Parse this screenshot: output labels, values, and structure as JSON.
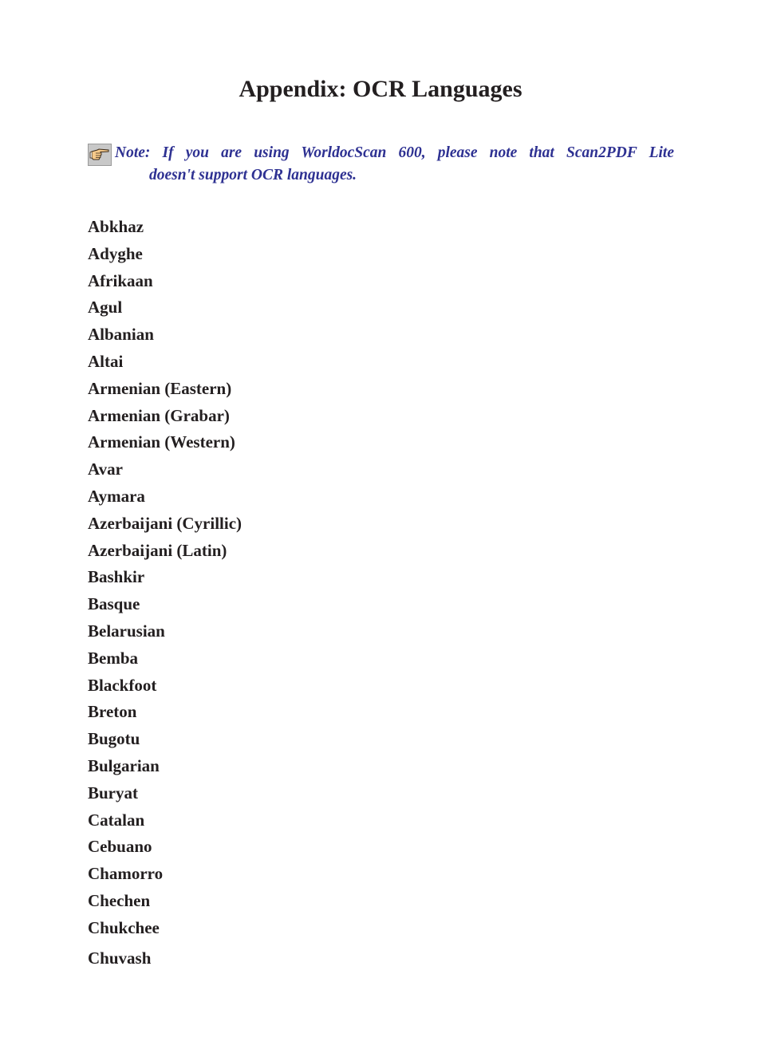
{
  "page": {
    "title": "Appendix: OCR Languages"
  },
  "note": {
    "icon": "pointing-hand-icon",
    "line1": "Note: If you are using WorldocScan 600, please note that Scan2PDF Lite",
    "line2": "doesn't support OCR languages.",
    "color": "#2e3192"
  },
  "languages": [
    "Abkhaz",
    "Adyghe",
    "Afrikaan",
    "Agul",
    "Albanian",
    "Altai",
    "Armenian (Eastern)",
    "Armenian (Grabar)",
    "Armenian (Western)",
    "Avar",
    "Aymara",
    "Azerbaijani (Cyrillic)",
    "Azerbaijani (Latin)",
    "Bashkir",
    "Basque",
    "Belarusian",
    "Bemba",
    "Blackfoot",
    "Breton",
    "Bugotu",
    "Bulgarian",
    "Buryat",
    "Catalan",
    "Cebuano",
    "Chamorro",
    "Chechen",
    "Chukchee",
    "Chuvash"
  ]
}
